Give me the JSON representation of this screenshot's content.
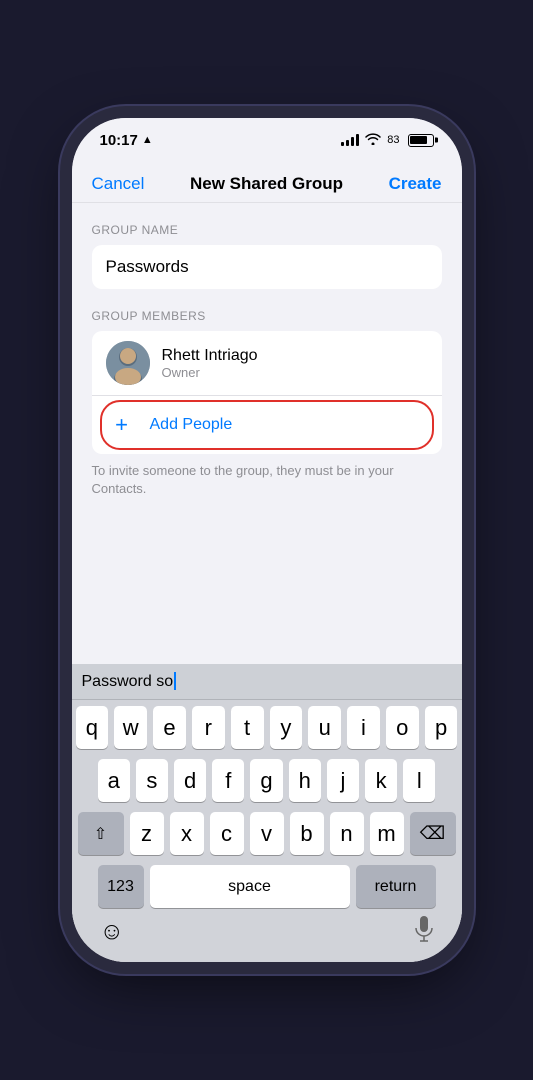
{
  "statusBar": {
    "time": "10:17",
    "locationArrow": "▲",
    "battery": "83",
    "batteryPercent": 83
  },
  "navBar": {
    "cancel": "Cancel",
    "title": "New Shared Group",
    "create": "Create"
  },
  "groupName": {
    "sectionLabel": "GROUP NAME",
    "value": "Passwords"
  },
  "groupMembers": {
    "sectionLabel": "GROUP MEMBERS",
    "members": [
      {
        "name": "Rhett Intriago",
        "role": "Owner"
      }
    ],
    "addPeople": "Add People"
  },
  "hintText": "To invite someone to the group, they must be in your Contacts.",
  "keyboard": {
    "suggestionText": "Password so",
    "rows": [
      [
        "q",
        "w",
        "e",
        "r",
        "t",
        "y",
        "u",
        "i",
        "o",
        "p"
      ],
      [
        "a",
        "s",
        "d",
        "f",
        "g",
        "h",
        "j",
        "k",
        "l"
      ],
      [
        "z",
        "x",
        "c",
        "v",
        "b",
        "n",
        "m"
      ],
      [
        "123",
        "space",
        "return"
      ]
    ],
    "spaceLabel": "space",
    "returnLabel": "return",
    "numericLabel": "123"
  }
}
